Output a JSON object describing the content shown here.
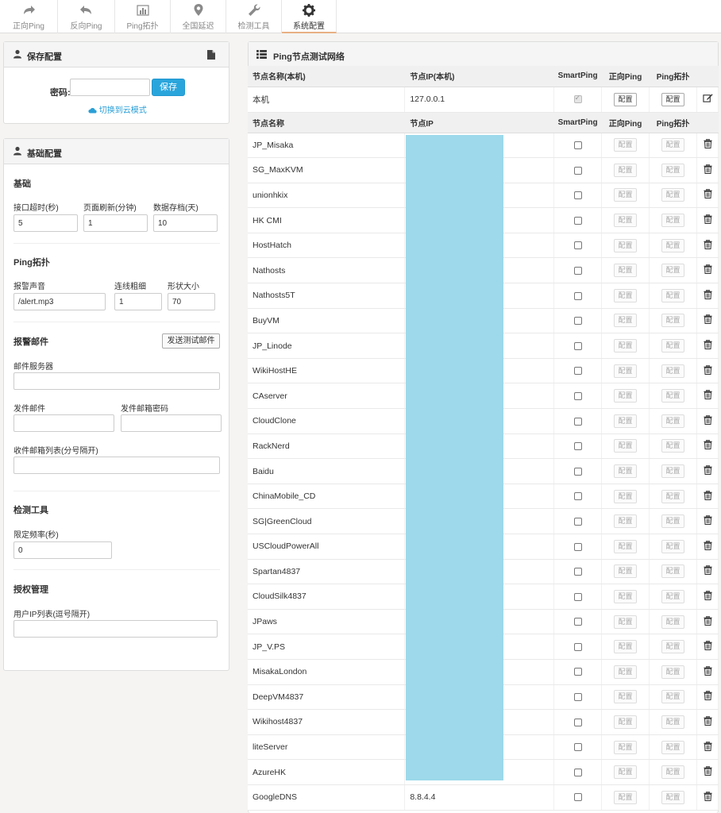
{
  "nav": {
    "tabs": [
      {
        "label": "正向Ping",
        "icon": "share-arrow-icon"
      },
      {
        "label": "反向Ping",
        "icon": "reply-arrow-icon"
      },
      {
        "label": "Ping拓扑",
        "icon": "bar-chart-icon"
      },
      {
        "label": "全国延迟",
        "icon": "map-pin-icon"
      },
      {
        "label": "检测工具",
        "icon": "wrench-icon"
      },
      {
        "label": "系统配置",
        "icon": "gear-icon"
      }
    ]
  },
  "save_panel": {
    "title": "保存配置",
    "password_label": "密码:",
    "password_value": "",
    "save_label": "保存",
    "cloud_link": "切换到云模式"
  },
  "basic_panel": {
    "title": "基础配置",
    "basic": {
      "heading": "基础",
      "timeout_label": "接口超时(秒)",
      "timeout_value": "5",
      "refresh_label": "页面刷新(分钟)",
      "refresh_value": "1",
      "archive_label": "数据存档(天)",
      "archive_value": "10"
    },
    "topology": {
      "heading": "Ping拓扑",
      "sound_label": "报警声音",
      "sound_value": "/alert.mp3",
      "line_label": "连线粗细",
      "line_value": "1",
      "shape_label": "形状大小",
      "shape_value": "70"
    },
    "mail": {
      "heading": "报警邮件",
      "test_button": "发送测试邮件",
      "server_label": "邮件服务器",
      "server_value": "",
      "sender_label": "发件邮件",
      "sender_value": "",
      "sender_pw_label": "发件邮箱密码",
      "sender_pw_value": "",
      "recipients_label": "收件邮箱列表(分号隔开)",
      "recipients_value": ""
    },
    "tools": {
      "heading": "检测工具",
      "rate_label": "限定频率(秒)",
      "rate_value": "0"
    },
    "auth": {
      "heading": "授权管理",
      "ip_label": "用户IP列表(逗号隔开)",
      "ip_value": ""
    }
  },
  "network_panel": {
    "title": "Ping节点测试网络",
    "local_headers": [
      "节点名称(本机)",
      "节点IP(本机)",
      "SmartPing",
      "正向Ping",
      "Ping拓扑"
    ],
    "local_node": {
      "name": "本机",
      "ip": "127.0.0.1"
    },
    "node_headers": [
      "节点名称",
      "节点IP",
      "SmartPing",
      "正向Ping",
      "Ping拓扑"
    ],
    "config_label": "配置",
    "nodes": [
      {
        "name": "JP_Misaka",
        "ip": ""
      },
      {
        "name": "SG_MaxKVM",
        "ip": ""
      },
      {
        "name": "unionhkix",
        "ip": ""
      },
      {
        "name": "HK CMI",
        "ip": ""
      },
      {
        "name": "HostHatch",
        "ip": ""
      },
      {
        "name": "Nathosts",
        "ip": ""
      },
      {
        "name": "Nathosts5T",
        "ip": ""
      },
      {
        "name": "BuyVM",
        "ip": ""
      },
      {
        "name": "JP_Linode",
        "ip": ""
      },
      {
        "name": "WikiHostHE",
        "ip": ""
      },
      {
        "name": "CAserver",
        "ip": ""
      },
      {
        "name": "CloudClone",
        "ip": ""
      },
      {
        "name": "RackNerd",
        "ip": ""
      },
      {
        "name": "Baidu",
        "ip": ""
      },
      {
        "name": "ChinaMobile_CD",
        "ip": ""
      },
      {
        "name": "SG|GreenCloud",
        "ip": ""
      },
      {
        "name": "USCloudPowerAll",
        "ip": ""
      },
      {
        "name": "Spartan4837",
        "ip": ""
      },
      {
        "name": "CloudSilk4837",
        "ip": ""
      },
      {
        "name": "JPaws",
        "ip": ""
      },
      {
        "name": "JP_V.PS",
        "ip": ""
      },
      {
        "name": "MisakaLondon",
        "ip": ""
      },
      {
        "name": "DeepVM4837",
        "ip": ""
      },
      {
        "name": "Wikihost4837",
        "ip": ""
      },
      {
        "name": "liteServer",
        "ip": ""
      },
      {
        "name": "AzureHK",
        "ip": ""
      },
      {
        "name": "GoogleDNS",
        "ip": "8.8.4.4"
      }
    ]
  }
}
